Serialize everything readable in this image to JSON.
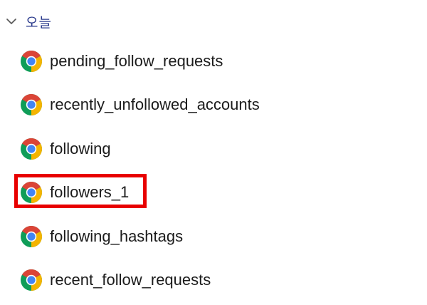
{
  "group": {
    "label": "오늘",
    "expanded": true,
    "chevron_icon": "chevron-down-icon"
  },
  "files": [
    {
      "name": "pending_follow_requests",
      "icon": "chrome-icon"
    },
    {
      "name": "recently_unfollowed_accounts",
      "icon": "chrome-icon"
    },
    {
      "name": "following",
      "icon": "chrome-icon"
    },
    {
      "name": "followers_1",
      "icon": "chrome-icon",
      "highlighted": true
    },
    {
      "name": "following_hashtags",
      "icon": "chrome-icon"
    },
    {
      "name": "recent_follow_requests",
      "icon": "chrome-icon"
    }
  ],
  "colors": {
    "group_label": "#2a3a8c",
    "highlight": "#e80000",
    "chrome_red": "#db4437",
    "chrome_green": "#0f9d58",
    "chrome_yellow": "#f4b400",
    "chrome_blue": "#4285f4"
  }
}
